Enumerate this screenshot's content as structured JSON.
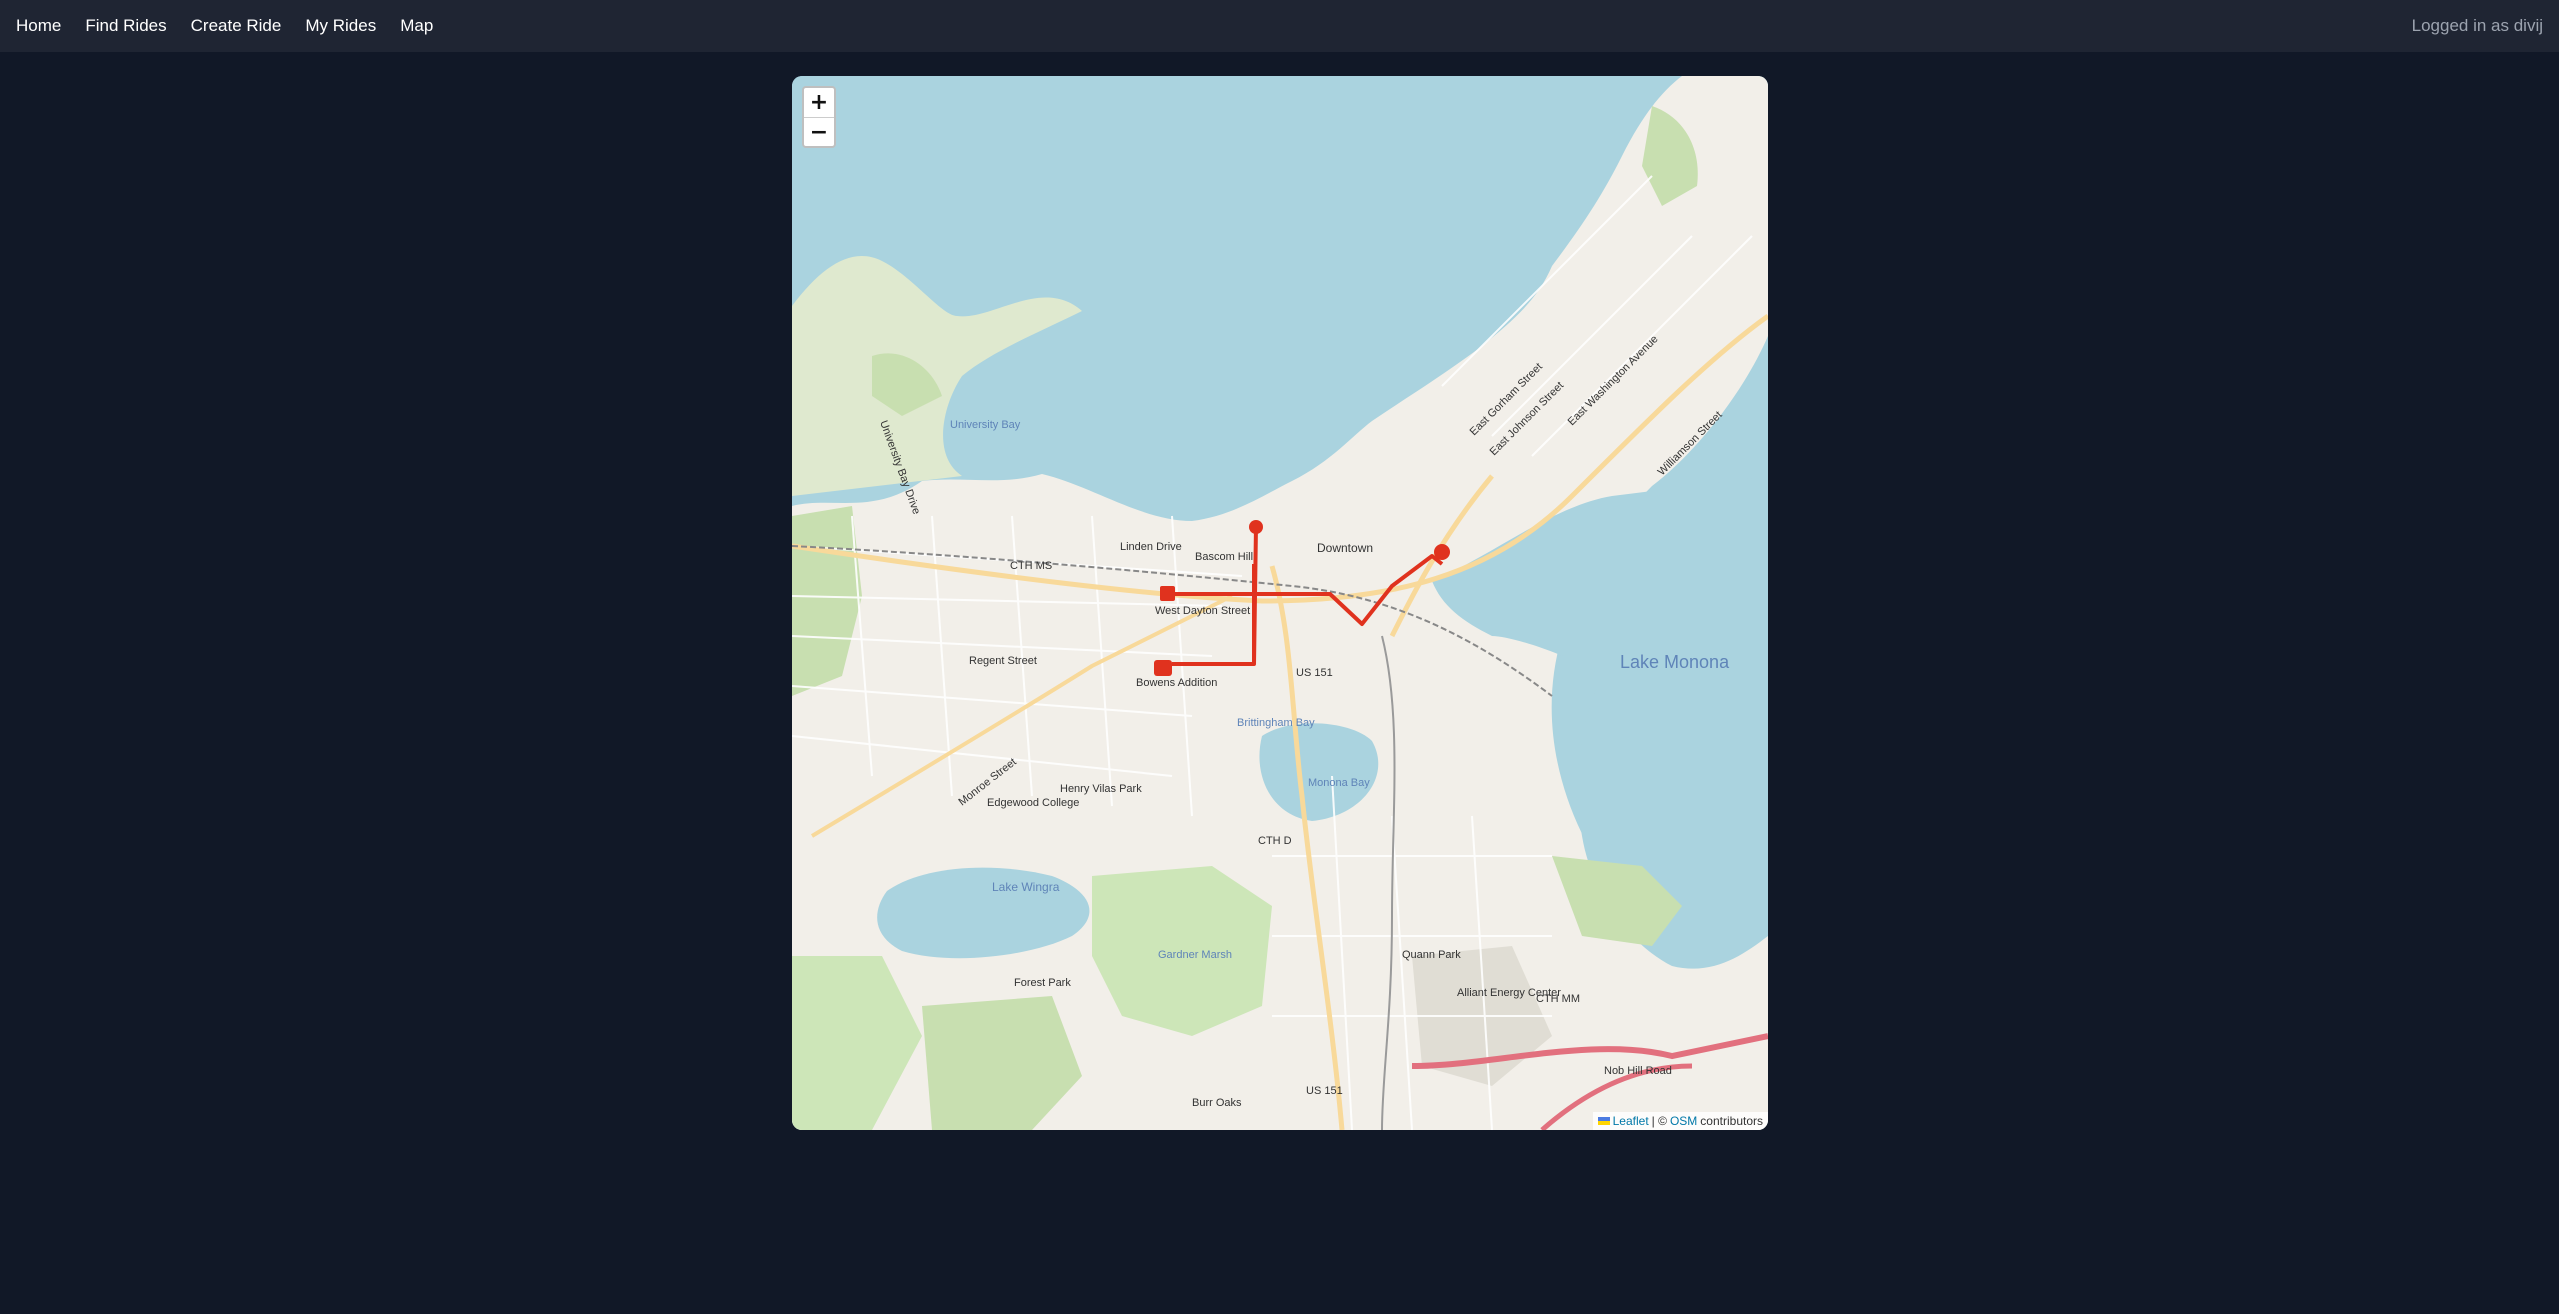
{
  "nav": {
    "items": [
      {
        "label": "Home"
      },
      {
        "label": "Find Rides"
      },
      {
        "label": "Create Ride"
      },
      {
        "label": "My Rides"
      },
      {
        "label": "Map"
      }
    ],
    "user_text": "Logged in as divij"
  },
  "map": {
    "zoom_in": "+",
    "zoom_out": "−",
    "attribution": {
      "leaflet": "Leaflet",
      "separator": "| ©",
      "osm": "OSM",
      "contributors": "contributors"
    },
    "labels": {
      "lake_monona": "Lake Monona",
      "lake_wingra": "Lake Wingra",
      "downtown": "Downtown",
      "linden_drive": "Linden Drive",
      "bascom_hill": "Bascom Hill",
      "west_dayton": "West Dayton Street",
      "regent": "Regent Street",
      "bowens": "Bowens Addition",
      "cth_ms": "CTH MS",
      "cth_d": "CTH D",
      "cth_mm": "CTH MM",
      "us151_top": "US 151",
      "us151_bottom": "US 151",
      "monona_bay": "Monona Bay",
      "brittingham_bay": "Brittingham Bay",
      "university_bay": "University Bay",
      "gardner_marsh": "Gardner Marsh",
      "alliant": "Alliant Energy Center",
      "quann": "Quann Park",
      "forest_park": "Forest Park",
      "edgewood": "Edgewood College",
      "henry_vilas": "Henry Vilas Park",
      "burr_oaks": "Burr Oaks",
      "east_gorham": "East Gorham Street",
      "east_johnson": "East Johnson Street",
      "east_washington": "East Washington Avenue",
      "williamson": "Williamson Street",
      "monroe": "Monroe Street",
      "nob_hill": "Nob Hill Road",
      "university_bay_drive": "University Bay Drive"
    }
  },
  "colors": {
    "background": "#111827",
    "navbar": "#1f2533",
    "water": "#aad3df",
    "route": "#e0321e"
  }
}
